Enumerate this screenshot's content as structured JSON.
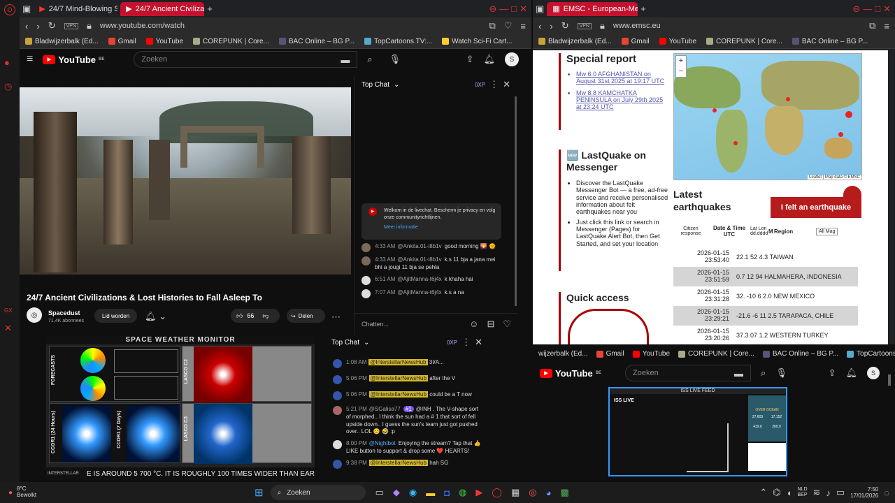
{
  "left_browser": {
    "tabs": [
      {
        "label": "24/7 Mind-Blowing Space"
      },
      {
        "label": "24/7 Ancient Civilizatio"
      }
    ],
    "url": "www.youtube.com/watch",
    "bookmarks": [
      "Bladwijzerbalk (Ed...",
      "Gmail",
      "YouTube",
      "COREPUNK | Core...",
      "BAC Online – BG P...",
      "TopCartoons.TV:...",
      "Watch Sci-Fi Cart..."
    ]
  },
  "youtube_main": {
    "logo": "YouTube",
    "logo_region": "BE",
    "search_placeholder": "Zoeken",
    "avatar_letter": "S",
    "video_title": "24/7 Ancient Civilizations & Lost Histories to Fall Asleep To",
    "channel_name": "Spacedust",
    "subscribers": "71,4K abonnees",
    "join_label": "Lid worden",
    "like_count": "66",
    "share_label": "Delen",
    "chat": {
      "header": "Top Chat",
      "xp": "0XP",
      "welcome_text": "Welkom in de livechat. Bescherm je privacy en volg onze communityrichtlijnen.",
      "welcome_link": "Meer informatie",
      "messages": [
        {
          "time": "4:33 AM",
          "name": "@Ankita.01-i8b1v",
          "text": "good morning 🌄 🌞"
        },
        {
          "time": "4:33 AM",
          "name": "@Ankita.01-i8b1v",
          "text": "k.s 11 bja a jana mei bhi a jougi 11 bja se pehla"
        },
        {
          "time": "6:51 AM",
          "name": "@AjitManna-t6j4x",
          "text": "k khaha hai"
        },
        {
          "time": "7:07 AM",
          "name": "@AjitManna-t6j4x",
          "text": "k.s a na"
        }
      ],
      "input_placeholder": "Chatten..."
    }
  },
  "space_weather": {
    "title": "SPACE WEATHER MONITOR",
    "panels": [
      "FORECASTS",
      "LASCO C2",
      "CCOR1 (24 Hours)",
      "CCOR1 (7 Days)",
      "LASCO C3"
    ],
    "forecast_date": "2026-01-15 06:00Z",
    "ticker": "E IS AROUND 5 700 °C.   IT IS ROUGHLY 100 TIMES WIDER THAN EAR",
    "brand": "INTERSTELLAR"
  },
  "bottom_chat": {
    "header": "Top Chat",
    "xp": "0XP",
    "messages": [
      {
        "time": "1:08 AM",
        "name": "@InterstellarNewsHub",
        "text": "3I/A..."
      },
      {
        "time": "5:06 PM",
        "name": "@InterstellarNewsHub",
        "text": "after the V"
      },
      {
        "time": "5:06 PM",
        "name": "@InterstellarNewsHub",
        "text": "could be a T now"
      },
      {
        "time": "5:21 PM",
        "name": "@SGalisa77",
        "badge": "#1",
        "text": "@INH . The V-shape sort of morphed.. I think the sun had a # 1 that sort of fell upside down.. I guess the sun's team just got pushed over.. LOL 😊 🤣 :p"
      },
      {
        "time": "8:00 PM",
        "name": "@Nightbot",
        "text": "Enjoying the stream? Tap that 👍 LIKE button to support & drop some ❤️ HEARTS!"
      },
      {
        "time": "9:38 PM",
        "name": "@InterstellarNewsHub",
        "text": "hah SG"
      }
    ]
  },
  "right_browser": {
    "tab": "EMSC - European-Mediter",
    "url": "www.emsc.eu",
    "bookmarks": [
      "Bladwijzerbalk (Ed...",
      "Gmail",
      "YouTube",
      "COREPUNK | Core...",
      "BAC Online – BG P..."
    ]
  },
  "emsc": {
    "special_report_title": "Special report",
    "reports": [
      "Mw 6.0 AFGHANISTAN on August 31st 2025 at 19:17 UTC",
      "Mw 8.8 KAMCHATKA PENINSULA on July 29th 2025 at 23:24 UTC"
    ],
    "lastquake_title": "🆕 LastQuake on Messenger",
    "lastquake_text_1": "Discover the LastQuake Messenger Bot — a free, ad-free service and receive personalised information about felt earthquakes near you",
    "lastquake_text_2": "Just click this link or search in Messenger (Pages) for LastQuake Alert Bot, then Get Started, and set your location",
    "quick_access_title": "Quick access",
    "map_attribution": "Leaflet | Map data © EMSC",
    "latest_title": "Latest earthquakes",
    "felt_button": "I felt an earthquake",
    "columns": [
      "Citizen response",
      "Date & Time UTC",
      "Lat Lon dd.dddd",
      "M",
      "Region"
    ],
    "filter": "All Mag",
    "quakes": [
      {
        "date": "2026-01-15",
        "time": "23:53:40",
        "lat": "22.1",
        "lon": "52",
        "mag": "4.3",
        "region": "TAIWAN"
      },
      {
        "date": "2026-01-15",
        "time": "23:51:59",
        "lat": "0.7",
        "lon": "12",
        "mag": "94",
        "region": "HALMAHERA, INDONESIA"
      },
      {
        "date": "2026-01-15",
        "time": "23:31:28",
        "lat": "32.",
        "lon": "-10",
        "mag": "6 2.0",
        "region": "NEW MEXICO"
      },
      {
        "date": "2026-01-15",
        "time": "23:29:21",
        "lat": "-21.6",
        "lon": "-6",
        "mag": "11 2.5",
        "region": "TARAPACA, CHILE"
      },
      {
        "date": "2026-01-15",
        "time": "23:20:26",
        "lat": "37.3",
        "lon": "07",
        "mag": "1.2",
        "region": "WESTERN TURKEY"
      }
    ]
  },
  "iss_window": {
    "bookmarks": [
      "wijzerbalk (Ed...",
      "Gmail",
      "YouTube",
      "COREPUNK | Core...",
      "BAC Online – BG P...",
      "TopCartoons.TV:..."
    ],
    "search_placeholder": "Zoeken",
    "avatar_letter": "S",
    "feed_title": "ISS LIVE FEED",
    "iss_label": "ISS LIVE",
    "over_ocean": "OVER OCEAN",
    "stats": [
      "27,603",
      "17,152",
      "419.0",
      "260.9"
    ]
  },
  "taskbar": {
    "weather_temp": "8°C",
    "weather_desc": "Bewolkt",
    "search": "Zoeken",
    "lang": "NLD",
    "lang2": "BEP",
    "time": "7:50",
    "date": "17/01/2026"
  }
}
